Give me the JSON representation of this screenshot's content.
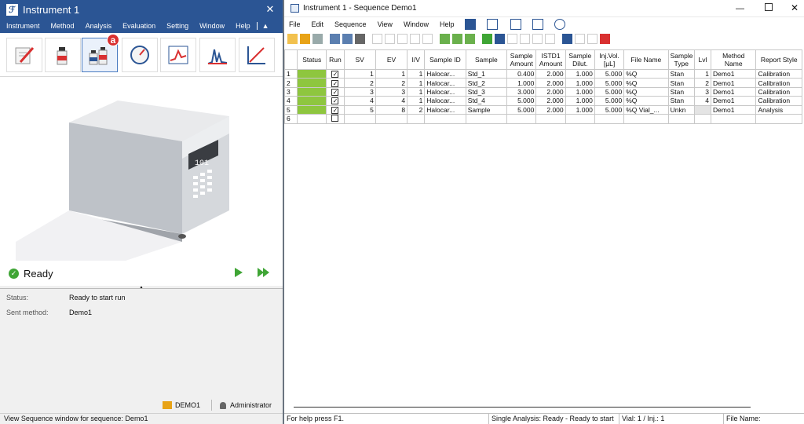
{
  "left": {
    "title": "Instrument 1",
    "menu": [
      "Instrument",
      "Method",
      "Analysis",
      "Evaluation",
      "Setting",
      "Window",
      "Help"
    ],
    "badge": "a",
    "display": "101",
    "ready": "Ready",
    "status_label": "Status:",
    "status_value": "Ready to start run",
    "method_label": "Sent method:",
    "method_value": "Demo1",
    "demo_label": "DEMO1",
    "user_label": "Administrator",
    "statusbar": "View Sequence window for sequence: Demo1"
  },
  "right": {
    "title": "Instrument 1 - Sequence Demo1",
    "menu": [
      "File",
      "Edit",
      "Sequence",
      "View",
      "Window",
      "Help"
    ],
    "headers": [
      "",
      "Status",
      "Run",
      "SV",
      "EV",
      "I/V",
      "Sample ID",
      "Sample",
      "Sample Amount",
      "ISTD1 Amount",
      "Sample Dilut.",
      "Inj.Vol. [µL]",
      "File Name",
      "Sample Type",
      "Lvl",
      "Method Name",
      "Report Style"
    ],
    "rows": [
      [
        "1",
        "",
        "✓",
        "1",
        "1",
        "1",
        "Halocar...",
        "Std_1",
        "0.400",
        "2.000",
        "1.000",
        "5.000",
        "%Q",
        "Stan",
        "1",
        "Demo1",
        "Calibration"
      ],
      [
        "2",
        "",
        "✓",
        "2",
        "2",
        "1",
        "Halocar...",
        "Std_2",
        "1.000",
        "2.000",
        "1.000",
        "5.000",
        "%Q",
        "Stan",
        "2",
        "Demo1",
        "Calibration"
      ],
      [
        "3",
        "",
        "✓",
        "3",
        "3",
        "1",
        "Halocar...",
        "Std_3",
        "3.000",
        "2.000",
        "1.000",
        "5.000",
        "%Q",
        "Stan",
        "3",
        "Demo1",
        "Calibration"
      ],
      [
        "4",
        "",
        "✓",
        "4",
        "4",
        "1",
        "Halocar...",
        "Std_4",
        "5.000",
        "2.000",
        "1.000",
        "5.000",
        "%Q",
        "Stan",
        "4",
        "Demo1",
        "Calibration"
      ],
      [
        "5",
        "",
        "✓",
        "5",
        "8",
        "2",
        "Halocar...",
        "Sample",
        "5.000",
        "2.000",
        "1.000",
        "5.000",
        "%Q Vial_...",
        "Unkn",
        "",
        "Demo1",
        "Analysis"
      ],
      [
        "6",
        "",
        "",
        "",
        "",
        "",
        "",
        "",
        "",
        "",
        "",
        "",
        "",
        "",
        "",
        "",
        ""
      ]
    ],
    "status_help": "For help press F1.",
    "status_analysis": "Single Analysis: Ready - Ready to start run",
    "status_vial": "Vial: 1 / Inj.: 1",
    "status_file": "File Name:"
  },
  "colors": {
    "title": "#2b5594",
    "ready_green": "#8ec63f",
    "play": "#3fa535"
  }
}
